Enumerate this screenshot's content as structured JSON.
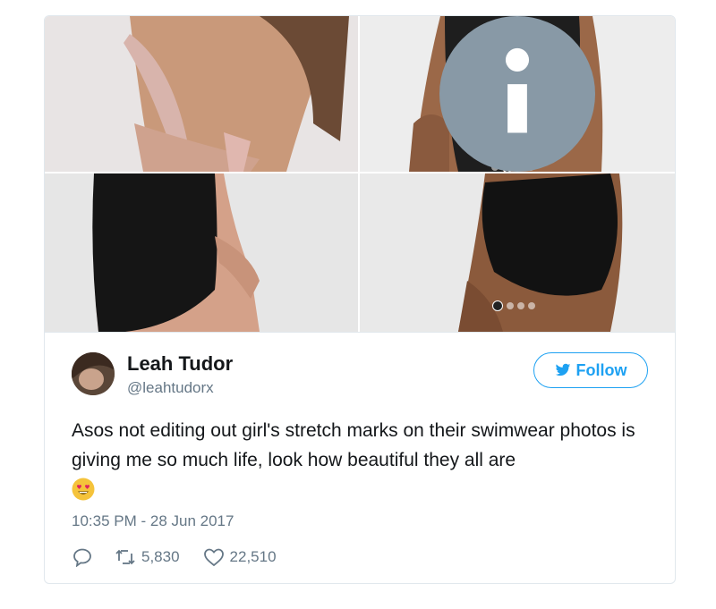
{
  "tweet": {
    "author": {
      "name": "Leah Tudor",
      "handle": "@leahtudorx"
    },
    "follow_label": "Follow",
    "text": "Asos not editing out girl's stretch marks on their swimwear photos is giving me so much life, look how beautiful they all are",
    "emoji": "heart-eyes-emoji",
    "timestamp": "10:35 PM - 28 Jun 2017",
    "actions": {
      "reply_icon": "reply-icon",
      "retweets": "5,830",
      "likes": "22,510"
    }
  },
  "media": {
    "images": [
      {
        "name": "photo-bikini-back",
        "colors": [
          "#e8e4e4",
          "#c9997a",
          "#e5b8b0"
        ]
      },
      {
        "name": "photo-mesh-swimsuit",
        "colors": [
          "#ededed",
          "#9b6848",
          "#1e1e1e"
        ]
      },
      {
        "name": "photo-black-swimsuit-side",
        "colors": [
          "#e6e6e6",
          "#d4a189",
          "#151515"
        ]
      },
      {
        "name": "photo-black-bottoms",
        "colors": [
          "#e9e9e9",
          "#8b5a3c",
          "#121212"
        ]
      }
    ],
    "carousel_dots": 4,
    "info_icon": "info-icon"
  },
  "colors": {
    "accent": "#1da1f2",
    "muted": "#657786",
    "border": "#e1e8ed"
  }
}
